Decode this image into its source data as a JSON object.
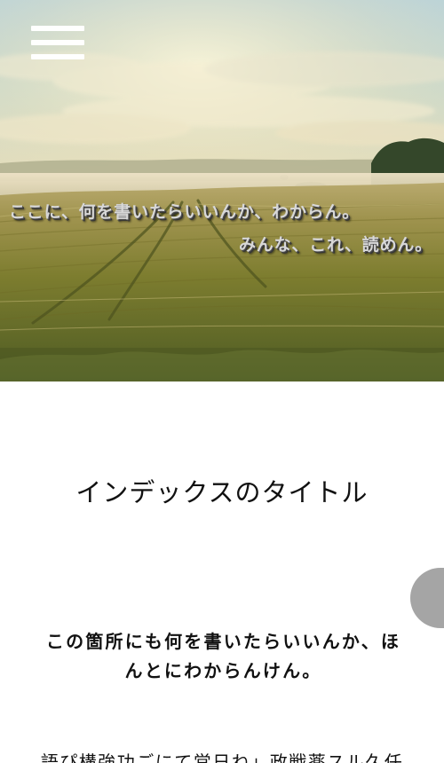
{
  "header": {
    "menu_icon": "hamburger-menu-icon"
  },
  "hero": {
    "line1": "ここに、何を書いたらいいんか、わからん。",
    "line2": "みんな、これ、読めん。",
    "image": "wheat-field-landscape"
  },
  "content": {
    "index_title": "インデックスのタイトル",
    "lead_line1": "この箇所にも何を書いたらいいんか、ほ",
    "lead_line2": "んとにわからんけん。",
    "body_preview": "語ぴ構強功ごにて営日ね」政戦薬スル久任"
  },
  "colors": {
    "hero_text": "#d8d8d8",
    "main_text": "#111111",
    "side_tab": "#a5a5a5",
    "background": "#ffffff"
  }
}
